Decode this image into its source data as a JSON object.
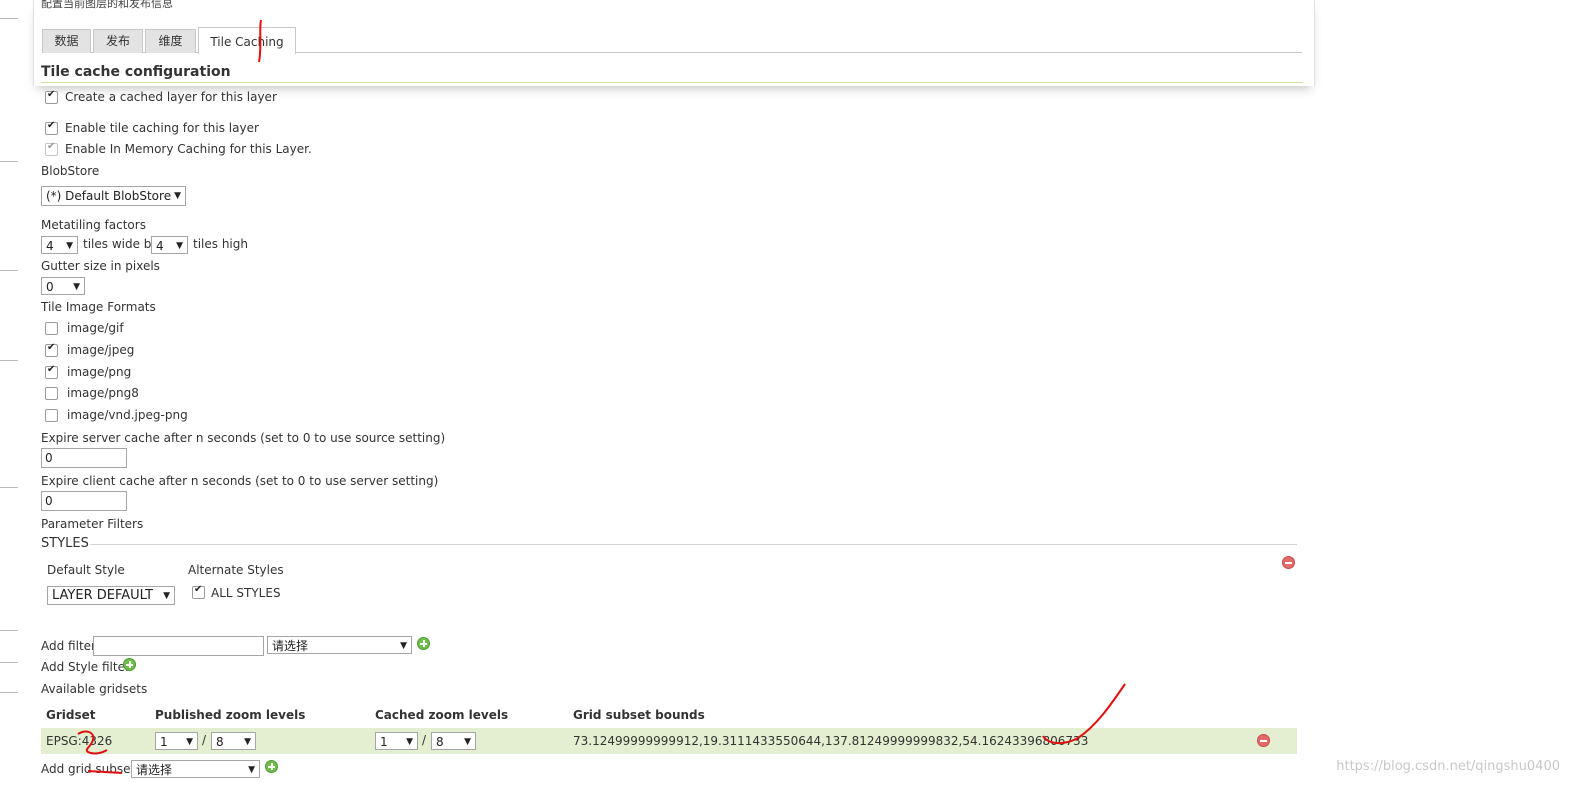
{
  "page": {
    "header_text": "配置当前图层的和发布信息",
    "watermark": "https://blog.csdn.net/qingshu0400"
  },
  "tabs": [
    {
      "label": "数据",
      "active": false
    },
    {
      "label": "发布",
      "active": false
    },
    {
      "label": "维度",
      "active": false
    },
    {
      "label": "Tile Caching",
      "active": true
    }
  ],
  "tile_cache": {
    "title": "Tile cache configuration",
    "create_cached_layer": {
      "label": "Create a cached layer for this layer",
      "checked": true
    },
    "enable_tile_caching": {
      "label": "Enable tile caching for this layer",
      "checked": true
    },
    "enable_in_memory": {
      "label": "Enable In Memory Caching for this Layer.",
      "checked": true
    },
    "blobstore": {
      "label": "BlobStore",
      "value": "(*) Default BlobStore"
    },
    "metatiling": {
      "label": "Metatiling factors",
      "wide_value": "4",
      "wide_suffix": "tiles wide by",
      "high_value": "4",
      "high_suffix": "tiles high"
    },
    "gutter": {
      "label": "Gutter size in pixels",
      "value": "0"
    },
    "formats": {
      "label": "Tile Image Formats",
      "items": [
        {
          "label": "image/gif",
          "checked": false
        },
        {
          "label": "image/jpeg",
          "checked": true
        },
        {
          "label": "image/png",
          "checked": true
        },
        {
          "label": "image/png8",
          "checked": false
        },
        {
          "label": "image/vnd.jpeg-png",
          "checked": false
        }
      ]
    },
    "expire_server": {
      "label": "Expire server cache after n seconds (set to 0 to use source setting)",
      "value": "0"
    },
    "expire_client": {
      "label": "Expire client cache after n seconds (set to 0 to use server setting)",
      "value": "0"
    },
    "parameter_filters": {
      "label": "Parameter Filters"
    }
  },
  "styles": {
    "heading": "STYLES",
    "default_style_label": "Default Style",
    "default_style_value": "LAYER DEFAULT",
    "alternate_styles_label": "Alternate Styles",
    "all_styles": {
      "label": "ALL STYLES",
      "checked": true
    }
  },
  "filters": {
    "add_filter_label": "Add filter",
    "add_filter_text": "",
    "add_filter_select": "请选择",
    "add_style_filter_label": "Add Style filter"
  },
  "gridsets": {
    "label": "Available gridsets",
    "columns": [
      "Gridset",
      "Published zoom levels",
      "Cached zoom levels",
      "Grid subset bounds"
    ],
    "rows": [
      {
        "gridset": "EPSG:4326",
        "published_min": "1",
        "published_max": "8",
        "cached_min": "1",
        "cached_max": "8",
        "separator": "/",
        "bounds": "73.12499999999912,19.3111433550644,137.81249999999832,54.16243396806733"
      }
    ],
    "add_grid_subset_label": "Add grid subset:",
    "add_grid_subset_select": "请选择"
  },
  "colors": {
    "row_highlight": "#e3efd0",
    "title_rule": "#cfe0a8",
    "annotation": "#e01010"
  }
}
